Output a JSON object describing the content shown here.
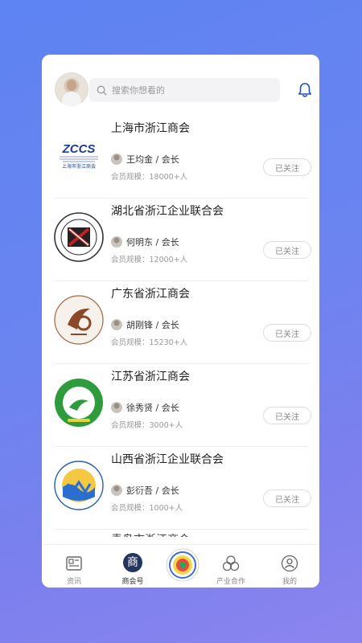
{
  "search": {
    "placeholder": "搜索你想看的"
  },
  "associations": [
    {
      "name": "上海市浙江商会",
      "leader": "王均金 / 会长",
      "scale": "会员规模：18000+人",
      "follow": "已关注",
      "logo_text": "ZCCS",
      "logo_sub": "上海市浙江商会"
    },
    {
      "name": "湖北省浙江企业联合会",
      "leader": "何明东 / 会长",
      "scale": "会员规模：12000+人",
      "follow": "已关注"
    },
    {
      "name": "广东省浙江商会",
      "leader": "胡刚锋 / 会长",
      "scale": "会员规模：15230+人",
      "follow": "已关注"
    },
    {
      "name": "江苏省浙江商会",
      "leader": "徐秀贤 / 会长",
      "scale": "会员规模：3000+人",
      "follow": "已关注"
    },
    {
      "name": "山西省浙江企业联合会",
      "leader": "彭衍吾 / 会长",
      "scale": "会员规模：1000+人",
      "follow": "已关注"
    }
  ],
  "partial_item": {
    "name": "青岛市浙江商会"
  },
  "tabs": [
    {
      "label": "资讯"
    },
    {
      "label": "商会号",
      "icon_char": "商"
    },
    {
      "label": ""
    },
    {
      "label": "产业合作"
    },
    {
      "label": "我的"
    }
  ],
  "colors": {
    "accent": "#1f4fc3",
    "tab_active_bg": "#24365f"
  }
}
